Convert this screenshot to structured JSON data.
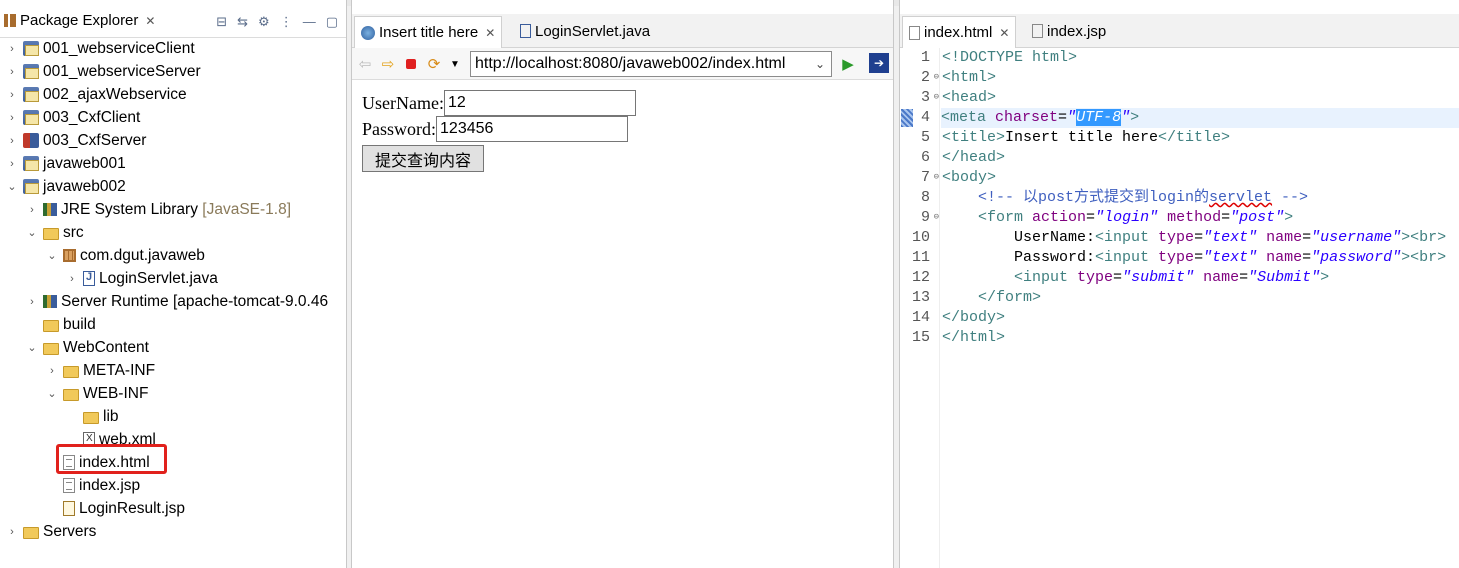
{
  "package_explorer": {
    "title": "Package Explorer",
    "items": [
      {
        "label": "001_webserviceClient",
        "icon": "project-icon"
      },
      {
        "label": "001_webserviceServer",
        "icon": "project-icon"
      },
      {
        "label": "002_ajaxWebservice",
        "icon": "project-icon"
      },
      {
        "label": "003_CxfClient",
        "icon": "project-icon"
      },
      {
        "label": "003_CxfServer",
        "icon": "project-icon"
      },
      {
        "label": "javaweb001",
        "icon": "project-icon"
      },
      {
        "label": "javaweb002",
        "icon": "project-icon"
      },
      {
        "label": "JRE System Library",
        "decoration": "[JavaSE-1.8]",
        "icon": "library-icon"
      },
      {
        "label": "src",
        "icon": "folder-icon"
      },
      {
        "label": "com.dgut.javaweb",
        "icon": "package-icon"
      },
      {
        "label": "LoginServlet.java",
        "icon": "java-file-icon"
      },
      {
        "label": "Server Runtime [apache-tomcat-9.0.46",
        "icon": "library-icon"
      },
      {
        "label": "build",
        "icon": "folder-icon"
      },
      {
        "label": "WebContent",
        "icon": "folder-icon"
      },
      {
        "label": "META-INF",
        "icon": "folder-icon"
      },
      {
        "label": "WEB-INF",
        "icon": "folder-icon"
      },
      {
        "label": "lib",
        "icon": "folder-icon"
      },
      {
        "label": "web.xml",
        "icon": "xml-file-icon"
      },
      {
        "label": "index.html",
        "icon": "html-file-icon"
      },
      {
        "label": "index.jsp",
        "icon": "jsp-file-icon"
      },
      {
        "label": "LoginResult.jsp",
        "icon": "jsp-file-icon"
      },
      {
        "label": "Servers",
        "icon": "folder-icon"
      }
    ]
  },
  "browser": {
    "tabs": [
      {
        "label": "Insert title here",
        "active": true
      },
      {
        "label": "LoginServlet.java",
        "active": false
      }
    ],
    "url": "http://localhost:8080/javaweb002/index.html",
    "form": {
      "username_label": "UserName:",
      "username_value": "12",
      "password_label": "Password:",
      "password_value": "123456",
      "submit_label": "提交查询内容"
    }
  },
  "editor": {
    "tabs": [
      {
        "label": "index.html",
        "active": true
      },
      {
        "label": "index.jsp",
        "active": false
      }
    ],
    "line_numbers": [
      "1",
      "2",
      "3",
      "4",
      "5",
      "6",
      "7",
      "8",
      "9",
      "10",
      "11",
      "12",
      "13",
      "14",
      "15"
    ]
  },
  "colors": {
    "highlight_box": "#e1211c",
    "tag": "#3f7f7f",
    "attribute": "#7f007f",
    "value": "#2a00ff",
    "comment": "#3f5fbf",
    "selection": "#3399ff"
  }
}
